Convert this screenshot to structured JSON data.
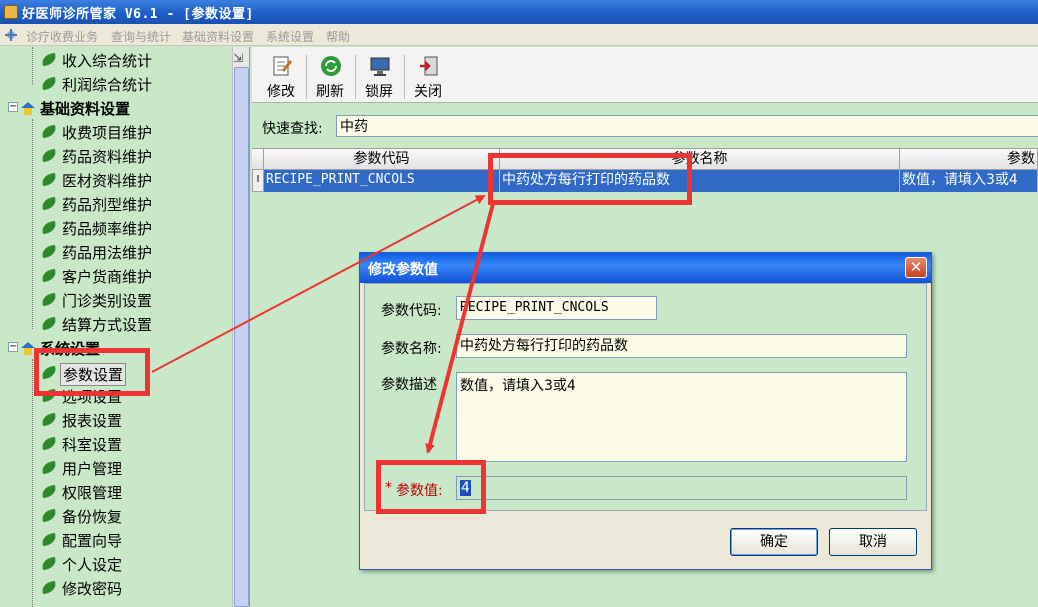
{
  "window": {
    "title": "好医师诊所管家 V6.1 - [参数设置]"
  },
  "menu": {
    "items": [
      "诊疗收费业务",
      "查询与统计",
      "基础资料设置",
      "系统设置",
      "帮助"
    ]
  },
  "sidebar": {
    "top_items": [
      "收入综合统计",
      "利润综合统计"
    ],
    "groups": [
      {
        "label": "基础资料设置",
        "items": [
          "收费项目维护",
          "药品资料维护",
          "医材资料维护",
          "药品剂型维护",
          "药品频率维护",
          "药品用法维护",
          "客户货商维护",
          "门诊类别设置",
          "结算方式设置"
        ]
      },
      {
        "label": "系统设置",
        "items": [
          "参数设置",
          "选项设置",
          "报表设置",
          "科室设置",
          "用户管理",
          "权限管理",
          "备份恢复",
          "配置向导",
          "个人设定",
          "修改密码"
        ]
      }
    ],
    "selected": "参数设置"
  },
  "toolbar": {
    "edit": "修改",
    "refresh": "刷新",
    "lock": "锁屏",
    "close": "关闭"
  },
  "search": {
    "label": "快速查找:",
    "value": "中药"
  },
  "grid": {
    "columns": [
      "参数代码",
      "参数名称",
      "参数"
    ],
    "row_indicator": "I",
    "rows": [
      {
        "code": "RECIPE_PRINT_CNCOLS",
        "name": "中药处方每行打印的药品数",
        "desc": "数值，请填入3或4"
      }
    ]
  },
  "dialog": {
    "title": "修改参数值",
    "code_label": "参数代码:",
    "code_value": "RECIPE_PRINT_CNCOLS",
    "name_label": "参数名称:",
    "name_value": "中药处方每行打印的药品数",
    "desc_label": "参数描述",
    "desc_value": "数值，请填入3或4",
    "value_marker": "*",
    "value_label": "参数值:",
    "value_value": "4",
    "ok": "确定",
    "cancel": "取消",
    "close_glyph": "✕"
  },
  "colors": {
    "annotation": "#ee3333",
    "selection": "#3169c6",
    "panel_bg": "#c8e8c8"
  }
}
